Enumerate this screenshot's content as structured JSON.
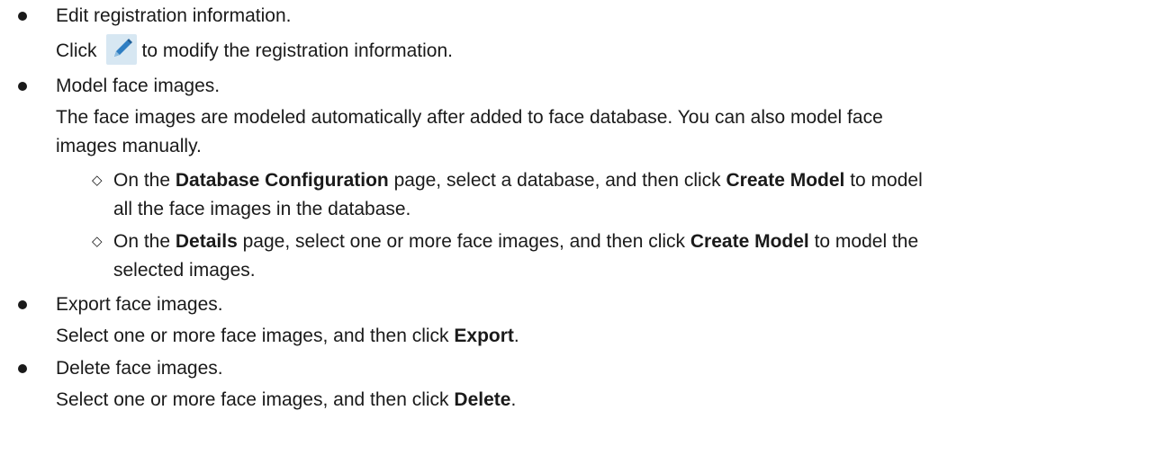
{
  "items": [
    {
      "title": "Edit registration information.",
      "body": {
        "before_icon": "Click",
        "icon": "edit-pencil-icon",
        "after_icon": "to modify the registration information."
      }
    },
    {
      "title": "Model face images.",
      "body_lines": [
        "The face images are modeled automatically after added to face database. You can also model face",
        "images manually."
      ],
      "sub_items": [
        {
          "prefix": "On the ",
          "bold_1": "Database Configuration",
          "middle": " page, select a database, and then click ",
          "bold_2": "Create Model",
          "suffix": " to model",
          "continuation": "all the face images in the database."
        },
        {
          "prefix": "On the ",
          "bold_1": "Details",
          "middle": " page, select one or more face images, and then click ",
          "bold_2": "Create Model",
          "suffix": " to model the",
          "continuation": "selected images."
        }
      ]
    },
    {
      "title": "Export face images.",
      "body": {
        "prefix": "Select one or more face images, and then click ",
        "bold": "Export",
        "suffix": "."
      }
    },
    {
      "title": "Delete face images.",
      "body": {
        "prefix": "Select one or more face images, and then click ",
        "bold": "Delete",
        "suffix": "."
      }
    }
  ],
  "sub_bullet_glyph": "◇",
  "colors": {
    "text": "#1a1a1a",
    "icon_bg": "#d7e7f2",
    "icon_fg": "#2f7ec2"
  }
}
